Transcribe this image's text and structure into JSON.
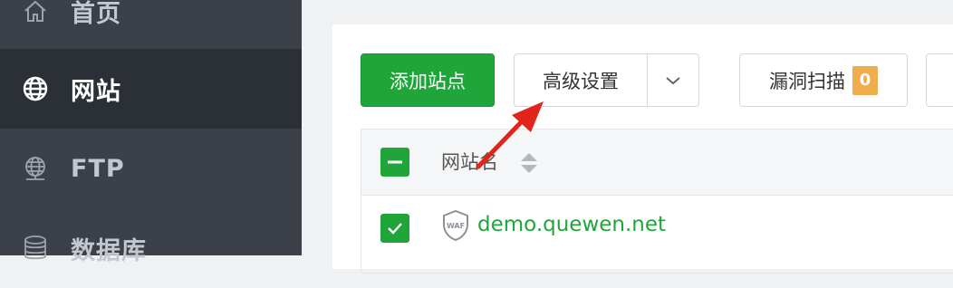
{
  "sidebar": {
    "items": [
      {
        "label": "首页",
        "icon": "home-icon"
      },
      {
        "label": "网站",
        "icon": "globe-icon",
        "active": true
      },
      {
        "label": "FTP",
        "icon": "ftp-globe-icon"
      },
      {
        "label": "数据库",
        "icon": "database-icon"
      }
    ]
  },
  "toolbar": {
    "add_site_label": "添加站点",
    "advanced_settings_label": "高级设置",
    "vuln_scan_label": "漏洞扫描",
    "vuln_scan_count": "0"
  },
  "table": {
    "header_site_name": "网站名",
    "rows": [
      {
        "site": "demo.quewen.net",
        "badge_icon": "waf-shield-icon",
        "checked": true
      }
    ]
  },
  "colors": {
    "accent_green": "#20a53a",
    "badge_orange": "#f0ad4e",
    "annotation_red": "#e1251b",
    "sidebar_bg": "#3c4049",
    "sidebar_active_bg": "#2b2f36"
  }
}
